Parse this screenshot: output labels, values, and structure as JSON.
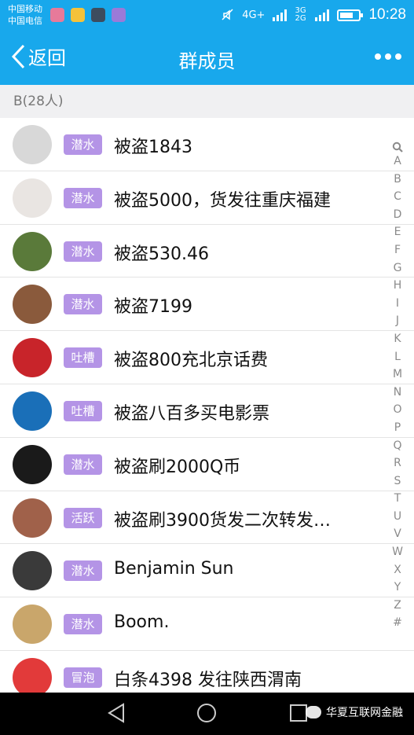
{
  "status_bar": {
    "carrier_1": "中国移动",
    "carrier_2": "中国电信",
    "network_1": "4G+",
    "network_2": "3G 2G",
    "time": "10:28",
    "battery_level": 0.7
  },
  "header": {
    "back_label": "返回",
    "title": "群成员"
  },
  "section": {
    "label": "B(28人)"
  },
  "members": [
    {
      "badge": "潜水",
      "name": "被盗1843",
      "avatar_color": "#d8d8d8"
    },
    {
      "badge": "潜水",
      "name": "被盗5000，货发往重庆福建",
      "avatar_color": "#e9e5e2"
    },
    {
      "badge": "潜水",
      "name": "被盗530.46",
      "avatar_color": "#5a7a3a"
    },
    {
      "badge": "潜水",
      "name": "被盗7199",
      "avatar_color": "#8a5a3c"
    },
    {
      "badge": "吐槽",
      "name": "被盗800充北京话费",
      "avatar_color": "#c8242a"
    },
    {
      "badge": "吐槽",
      "name": "被盗八百多买电影票",
      "avatar_color": "#1a6fb8"
    },
    {
      "badge": "潜水",
      "name": "被盗刷2000Q币",
      "avatar_color": "#1a1a1a"
    },
    {
      "badge": "活跃",
      "name": "被盗刷3900货发二次转发…",
      "avatar_color": "#a0614a"
    },
    {
      "badge": "潜水",
      "name": "Benjamin Sun",
      "avatar_color": "#3a3a3a"
    },
    {
      "badge": "潜水",
      "name": "Boom.",
      "avatar_color": "#c9a66b"
    },
    {
      "badge": "冒泡",
      "name": "白条4398 发往陕西渭南",
      "avatar_color": "#e23a3a"
    }
  ],
  "index_letters": [
    "A",
    "B",
    "C",
    "D",
    "E",
    "F",
    "G",
    "H",
    "I",
    "J",
    "K",
    "L",
    "M",
    "N",
    "O",
    "P",
    "Q",
    "R",
    "S",
    "T",
    "U",
    "V",
    "W",
    "X",
    "Y",
    "Z",
    "#"
  ],
  "watermark": {
    "text": "华夏互联网金融"
  },
  "colors": {
    "brand_blue": "#18a8ec",
    "badge_purple": "#b494e6",
    "section_bg": "#f0f0f2"
  }
}
